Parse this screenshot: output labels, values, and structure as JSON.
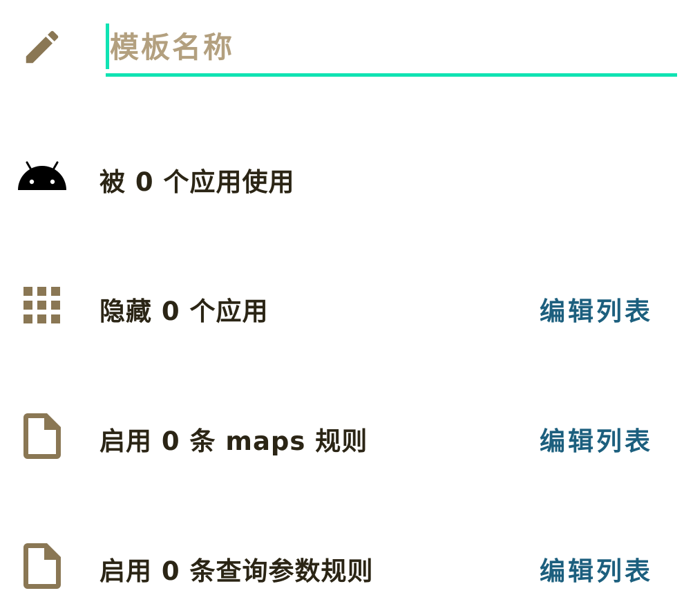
{
  "form": {
    "name_field": {
      "placeholder": "模板名称",
      "value": "",
      "icon": "edit-pencil-icon"
    }
  },
  "rows": [
    {
      "icon": "android-icon",
      "label": "被 0 个应用使用",
      "action": ""
    },
    {
      "icon": "apps-grid-icon",
      "label": "隐藏 0 个应用",
      "action": "编辑列表"
    },
    {
      "icon": "document-icon",
      "label": "启用 0 条 maps 规则",
      "action": "编辑列表"
    },
    {
      "icon": "document-icon",
      "label": "启用 0 条查询参数规则",
      "action": "编辑列表"
    }
  ],
  "colors": {
    "accent": "#10e3b3",
    "icon": "#8a7754",
    "text": "#2b2515",
    "action": "#1c5f7e",
    "placeholder": "#b3a07f"
  }
}
